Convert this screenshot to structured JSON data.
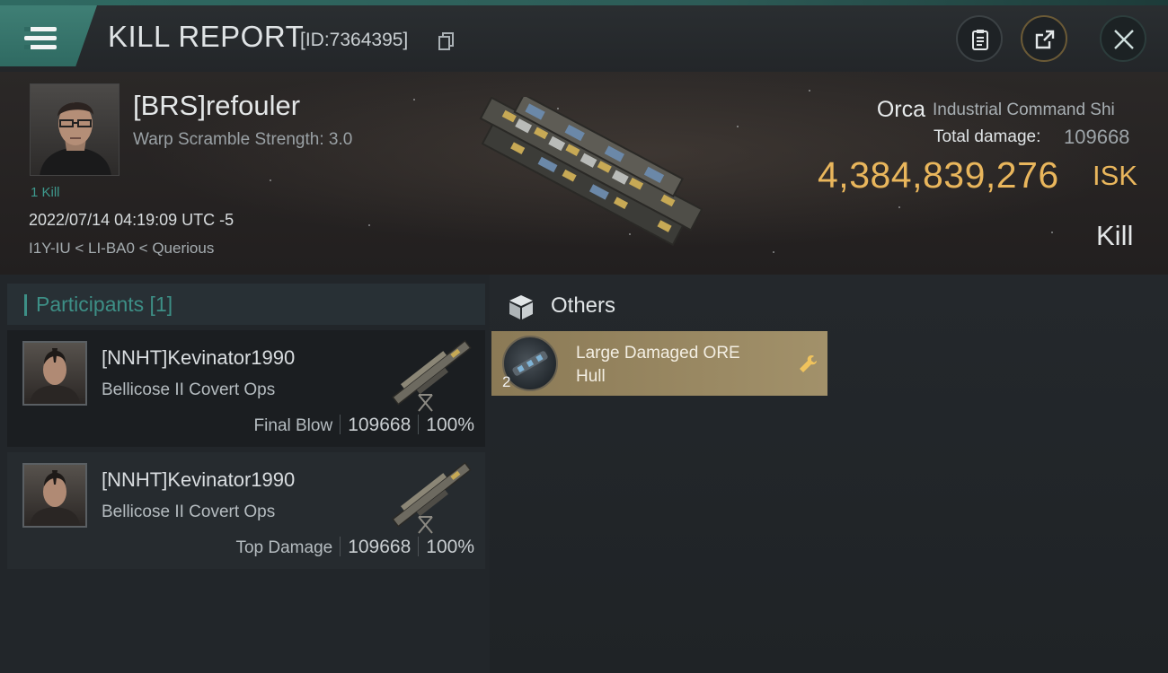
{
  "header": {
    "title": "KILL REPORT",
    "id_text": "[ID:7364395]",
    "icons": {
      "menu": "hamburger-icon",
      "copy": "copy-icon",
      "clipboard": "clipboard-icon",
      "share": "share-icon",
      "close": "close-icon"
    }
  },
  "victim": {
    "name": "[BRS]refouler",
    "subtitle": "Warp Scramble Strength: 3.0",
    "kills": "1 Kill",
    "datetime": "2022/07/14 04:19:09 UTC -5",
    "location": "I1Y-IU < LI-BA0 < Querious",
    "ship_name": "Orca",
    "ship_class": "Industrial Command Shi",
    "total_damage_label": "Total damage:",
    "total_damage": "109668",
    "isk_value": "4,384,839,276",
    "isk_unit": "ISK",
    "result": "Kill"
  },
  "participants": {
    "title": "Participants [1]",
    "items": [
      {
        "name": "[NNHT]Kevinator1990",
        "ship": "Bellicose II Covert Ops",
        "label": "Final Blow",
        "damage": "109668",
        "percent": "100%"
      },
      {
        "name": "[NNHT]Kevinator1990",
        "ship": "Bellicose II Covert Ops",
        "label": "Top Damage",
        "damage": "109668",
        "percent": "100%"
      }
    ]
  },
  "others": {
    "title": "Others",
    "items": [
      {
        "name": "Large Damaged ORE Hull",
        "qty": "2",
        "icon": "wrench-icon"
      }
    ]
  },
  "colors": {
    "accent_teal": "#3d8f86",
    "isk_gold": "#e9b65c",
    "item_card": "#9a8962"
  }
}
